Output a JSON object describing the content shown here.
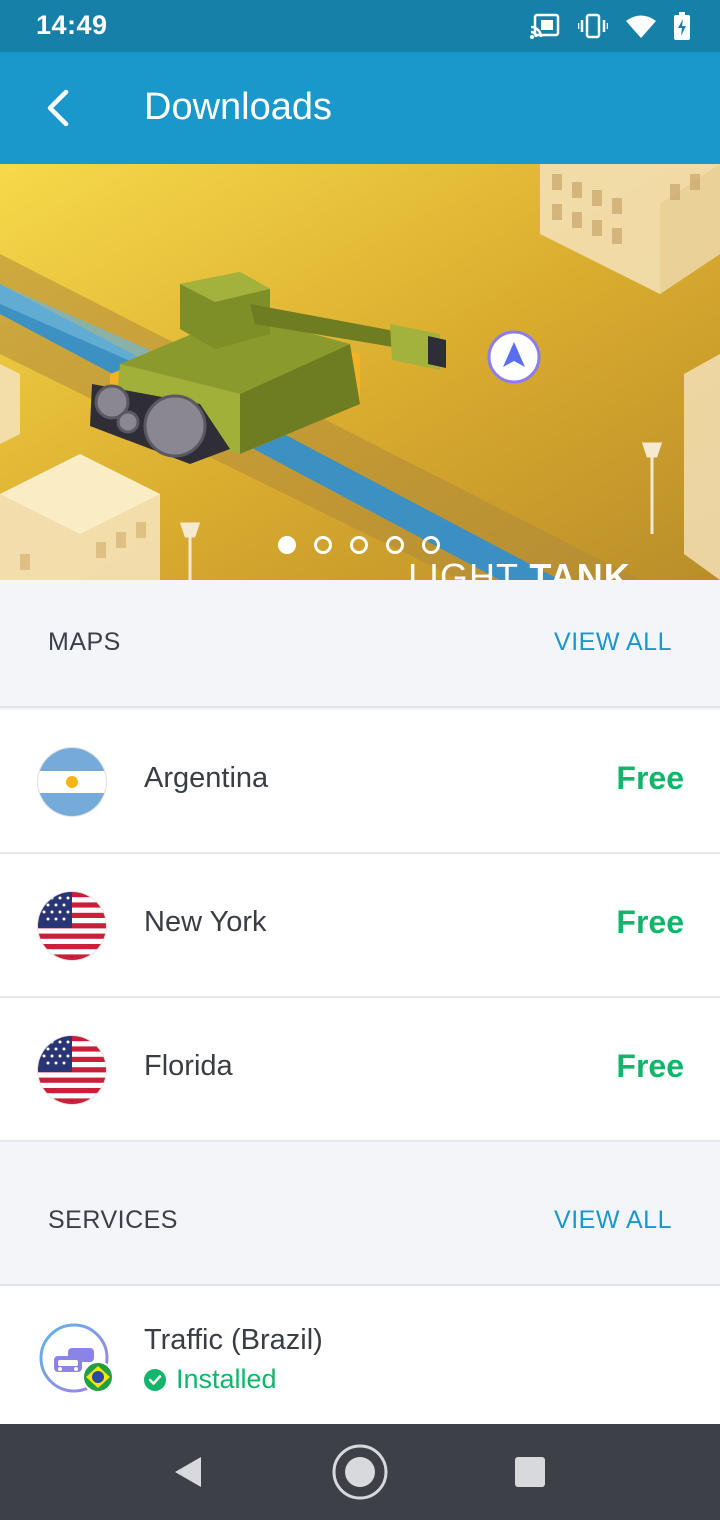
{
  "status_bar": {
    "time": "14:49",
    "icons": [
      "cast-icon",
      "vibrate-icon",
      "wifi-icon",
      "battery-charging-icon"
    ]
  },
  "app_bar": {
    "title": "Downloads",
    "back_icon": "back-arrow-icon"
  },
  "banner": {
    "title_thin": "LIGHT",
    "title_bold": "TANK",
    "slide_count": 5,
    "active_slide": 1
  },
  "maps": {
    "header": "MAPS",
    "view_all": "VIEW ALL",
    "items": [
      {
        "name": "Argentina",
        "price": "Free",
        "flag": "argentina-flag-icon"
      },
      {
        "name": "New York",
        "price": "Free",
        "flag": "usa-flag-icon"
      },
      {
        "name": "Florida",
        "price": "Free",
        "flag": "usa-flag-icon"
      }
    ]
  },
  "services": {
    "header": "SERVICES",
    "view_all": "VIEW ALL",
    "items": [
      {
        "name": "Traffic (Brazil)",
        "status": "Installed",
        "icon": "traffic-cars-icon",
        "badge": "brazil-flag-icon"
      }
    ]
  },
  "nav_bar": {
    "buttons": [
      "back-triangle-icon",
      "home-circle-icon",
      "recents-square-icon"
    ]
  },
  "colors": {
    "status_bar": "#1780a8",
    "app_bar": "#1b98cb",
    "accent": "#1b98cb",
    "free_green": "#13b56b",
    "nav_bar": "#3d4046"
  }
}
